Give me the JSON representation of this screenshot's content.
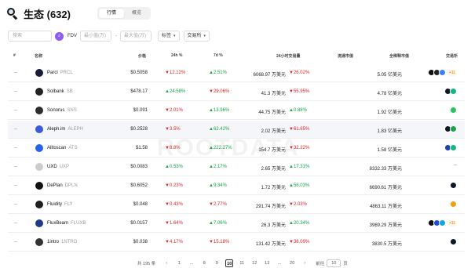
{
  "header": {
    "title": "生态 (632)",
    "tabs": [
      "行情",
      "概览"
    ],
    "active_tab": 0
  },
  "filters": {
    "search_placeholder": "搜索",
    "fdv_label": "FDV",
    "min_placeholder": "最小值(万)",
    "dash": "-",
    "max_placeholder": "最大值(万)",
    "tag_label": "标签",
    "exchange_label": "交易所"
  },
  "table": {
    "headers": {
      "rank": "#",
      "name": "名称",
      "price": "价格",
      "change_24h": "24h %",
      "change_7d": "7d %",
      "volume": "24小时交易量",
      "mcap": "流通市值",
      "fdv": "全稀释市值",
      "exchange": "交易所"
    },
    "rows": [
      {
        "rank": "--",
        "name": "Parcl",
        "symbol": "PRCL",
        "price": "$0.5058",
        "c24": "12.12%",
        "c24_dir": "down",
        "c7": "2.51%",
        "c7_dir": "up",
        "volume": "6068.97 万美元",
        "vol_change": "26.02%",
        "vol_dir": "down",
        "mcap": "",
        "fdv": "5.05 亿美元",
        "logo_color": "#1a1a3a",
        "exchanges": [
          "#111111",
          "#222222",
          "#3b82f6"
        ],
        "more": "+11"
      },
      {
        "rank": "--",
        "name": "Solbank",
        "symbol": "SB",
        "price": "$478.17",
        "c24": "24.58%",
        "c24_dir": "up",
        "c7": "29.06%",
        "c7_dir": "down",
        "volume": "41.3 万美元",
        "vol_change": "55.95%",
        "vol_dir": "down",
        "mcap": "",
        "fdv": "4.78 亿美元",
        "logo_color": "#222222",
        "exchanges": [
          "#0f172a",
          "#10b981"
        ],
        "more": ""
      },
      {
        "rank": "--",
        "name": "Sonorus",
        "symbol": "SNS",
        "price": "$0.091",
        "c24": "2.01%",
        "c24_dir": "down",
        "c7": "13.96%",
        "c7_dir": "up",
        "volume": "44.75 万美元",
        "vol_change": "0.88%",
        "vol_dir": "up",
        "mcap": "",
        "fdv": "1.92 亿美元",
        "logo_color": "#2d2d2d",
        "exchanges": [
          "#22c55e"
        ],
        "more": ""
      },
      {
        "rank": "--",
        "name": "Aleph.im",
        "symbol": "ALEPH",
        "price": "$0.2528",
        "c24": "3.5%",
        "c24_dir": "down",
        "c7": "62.42%",
        "c7_dir": "up",
        "volume": "2.02 万美元",
        "vol_change": "61.65%",
        "vol_dir": "down",
        "mcap": "",
        "fdv": "1.83 亿美元",
        "logo_color": "#3b5bdb",
        "exchanges": [
          "#0f172a",
          "#16a34a"
        ],
        "more": ""
      },
      {
        "rank": "--",
        "name": "Alltoscan",
        "symbol": "ATS",
        "price": "$1.58",
        "c24": "8.8%",
        "c24_dir": "down",
        "c7": "222.27%",
        "c7_dir": "up",
        "volume": "154.7 万美元",
        "vol_change": "32.22%",
        "vol_dir": "down",
        "mcap": "",
        "fdv": "1.58 亿美元",
        "logo_color": "#2563eb",
        "exchanges": [
          "#1e40af",
          "#10b981"
        ],
        "more": ""
      },
      {
        "rank": "--",
        "name": "UXD",
        "symbol": "UXP",
        "price": "$0.0083",
        "c24": "0.53%",
        "c24_dir": "up",
        "c7": "2.17%",
        "c7_dir": "up",
        "volume": "2.65 万美元",
        "vol_change": "17.31%",
        "vol_dir": "up",
        "mcap": "",
        "fdv": "8332.33 万美元",
        "logo_color": "#cccccc",
        "exchanges": [],
        "more": ""
      },
      {
        "rank": "--",
        "name": "DePlan",
        "symbol": "DPLN",
        "price": "$0.6052",
        "c24": "0.23%",
        "c24_dir": "down",
        "c7": "9.34%",
        "c7_dir": "up",
        "volume": "1.72 万美元",
        "vol_change": "58.03%",
        "vol_dir": "up",
        "mcap": "",
        "fdv": "6690.61 万美元",
        "logo_color": "#111111",
        "exchanges": [
          "#0f172a"
        ],
        "more": ""
      },
      {
        "rank": "--",
        "name": "Fluidity",
        "symbol": "FLY",
        "price": "$0.048",
        "c24": "0.43%",
        "c24_dir": "down",
        "c7": "2.77%",
        "c7_dir": "down",
        "volume": "291.74 万美元",
        "vol_change": "2.03%",
        "vol_dir": "down",
        "mcap": "",
        "fdv": "4863.11 万美元",
        "logo_color": "#1f1f1f",
        "exchanges": [
          "#f59e0b"
        ],
        "more": ""
      },
      {
        "rank": "--",
        "name": "FluxBeam",
        "symbol": "FLUXB",
        "price": "$0.0157",
        "c24": "1.64%",
        "c24_dir": "down",
        "c7": "7.06%",
        "c7_dir": "up",
        "volume": "26.3 万美元",
        "vol_change": "20.34%",
        "vol_dir": "up",
        "mcap": "",
        "fdv": "3969.29 万美元",
        "logo_color": "#1e3a8a",
        "exchanges": [
          "#111111",
          "#1d4ed8",
          "#0ea5e9"
        ],
        "more": "+11"
      },
      {
        "rank": "--",
        "name": "1intro",
        "symbol": "1NTRO",
        "price": "$0.038",
        "c24": "4.17%",
        "c24_dir": "down",
        "c7": "15.18%",
        "c7_dir": "down",
        "volume": "131.42 万美元",
        "vol_change": "38.09%",
        "vol_dir": "down",
        "mcap": "",
        "fdv": "3830.5 万美元",
        "logo_color": "#333333",
        "exchanges": [
          "#0f172a"
        ],
        "more": ""
      }
    ]
  },
  "watermark": "ROOTDATA",
  "pagination": {
    "total": "共 195 条",
    "prev": "‹",
    "pages": [
      "1",
      "...",
      "8",
      "9",
      "10",
      "11",
      "12",
      "13",
      "...",
      "20"
    ],
    "active": "10",
    "next": "›",
    "jump_label": "前往",
    "jump_value": "10",
    "page_suffix": "页"
  }
}
